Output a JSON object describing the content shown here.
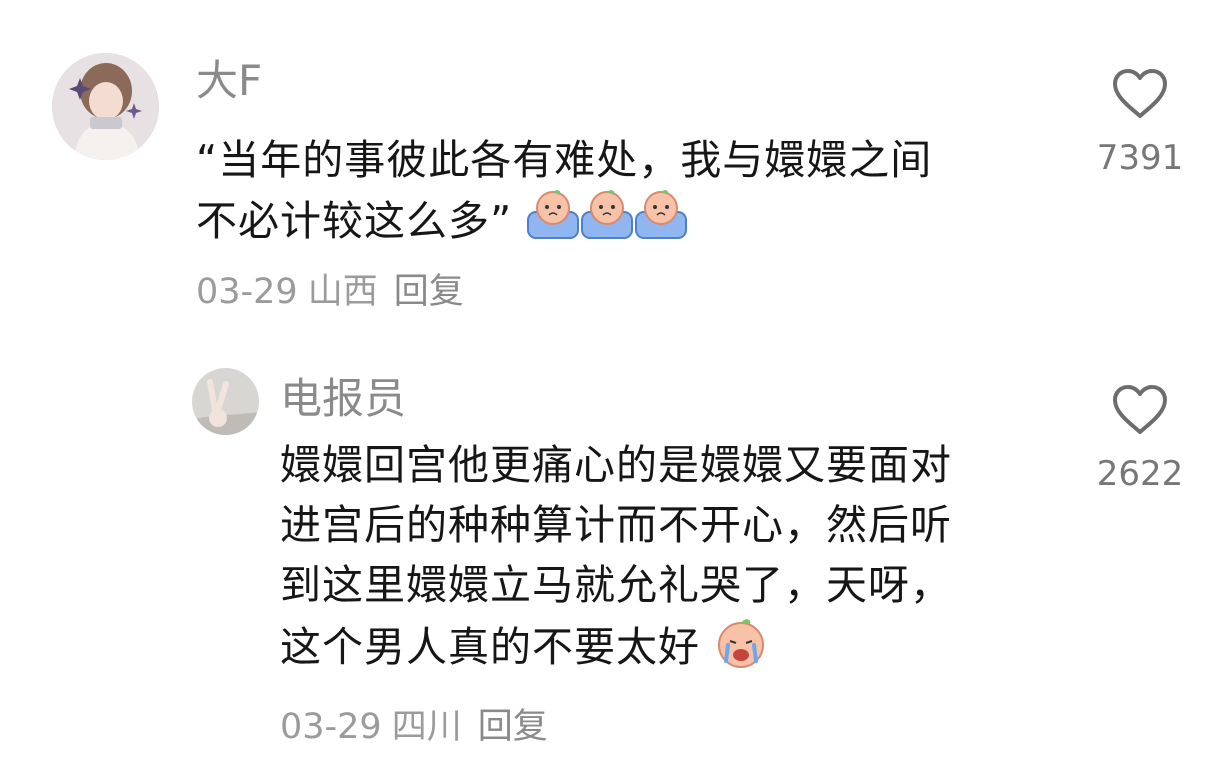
{
  "comments": [
    {
      "username": "大F",
      "text_lines": [
        "“当年的事彼此各有难处，我与嬛嬛之间",
        "不必计较这么多”"
      ],
      "emoji": "crying-peach-emoji",
      "date": "03-29",
      "location": "山西",
      "reply_label": "回复",
      "likes": "7391",
      "icon": "heart-outline-icon"
    },
    {
      "username": "电报员",
      "text_lines": [
        "嬛嬛回宫他更痛心的是嬛嬛又要面对",
        "进宫后的种种算计而不开心，然后听",
        "到这里嬛嬛立马就允礼哭了，天呀，",
        "这个男人真的不要太好"
      ],
      "emoji": "crying-peach-emoji",
      "date": "03-29",
      "location": "四川",
      "reply_label": "回复",
      "likes": "2622",
      "icon": "heart-outline-icon"
    }
  ],
  "colors": {
    "username": "#8a8a8a",
    "text": "#161616",
    "meta": "#9b9b9b",
    "icon": "#6d6d6d"
  }
}
